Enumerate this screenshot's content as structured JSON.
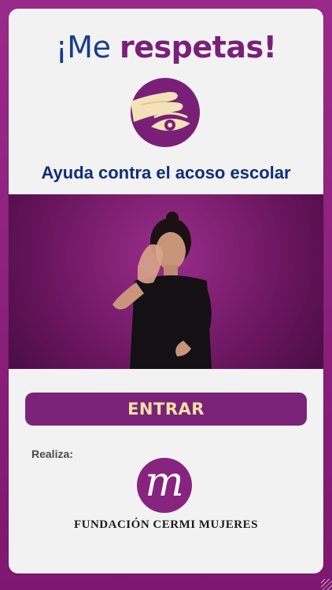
{
  "header": {
    "title_part1": "¡Me ",
    "title_part2": "respetas!",
    "subtitle": "Ayuda contra el acoso escolar"
  },
  "video": {
    "description_icon": "sign-language-interpreter"
  },
  "actions": {
    "enter_label": "ENTRAR"
  },
  "footer": {
    "realiza_label": "Realiza:",
    "org_logo_letter": "m",
    "org_name": "FUNDACIÓN CERMI MUJERES"
  },
  "colors": {
    "brand_purple": "#7b2378",
    "title_blue": "#1a3d8a",
    "button_text": "#f6e0a6"
  }
}
